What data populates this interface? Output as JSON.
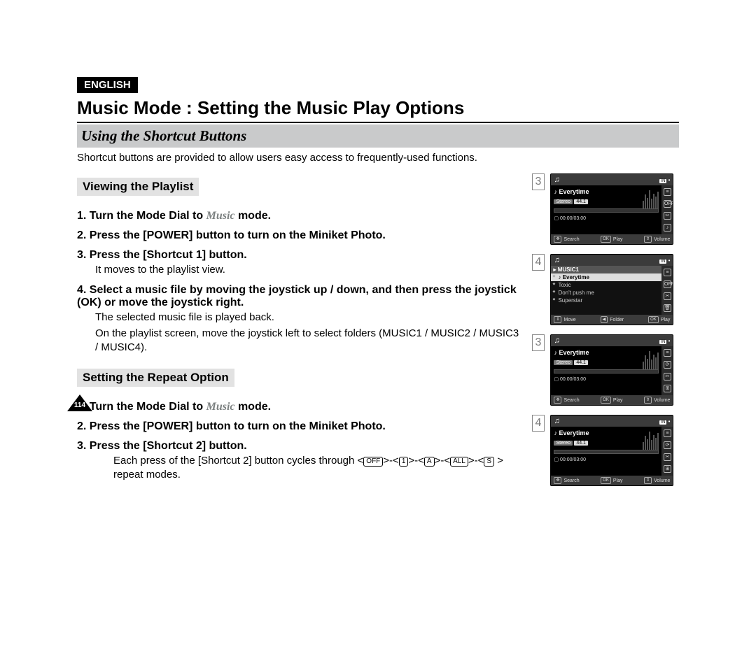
{
  "lang_badge": "ENGLISH",
  "title": "Music Mode : Setting the Music Play Options",
  "section_title": "Using the Shortcut Buttons",
  "intro": "Shortcut buttons are provided to allow users easy access to frequently-used functions.",
  "page_number": "114",
  "viewing": {
    "heading": "Viewing the Playlist",
    "steps": {
      "s1_prefix": "1. Turn the Mode Dial to ",
      "s1_mode": "Music",
      "s1_suffix": " mode.",
      "s2": "2. Press the [POWER] button to turn on the Miniket Photo.",
      "s3": "3. Press the [Shortcut 1] button.",
      "s3_sub": "It moves to the playlist view.",
      "s4": "4. Select a music file by moving the joystick up / down, and then press the joystick (OK) or move the joystick right.",
      "s4_sub1": "The selected music file is played back.",
      "s4_sub2": "On the playlist screen, move the joystick left to select folders (MUSIC1 / MUSIC2 / MUSIC3 / MUSIC4)."
    }
  },
  "repeat": {
    "heading": "Setting the Repeat Option",
    "steps": {
      "s1_prefix": "1. Turn the Mode Dial to ",
      "s1_mode": "Music",
      "s1_suffix": " mode.",
      "s2": "2. Press the [POWER] button to turn on the Miniket Photo.",
      "s3": "3. Press the [Shortcut 2] button.",
      "s3_sub_prefix": "Each press of the [Shortcut 2] button cycles through <",
      "s3_sub_mid": ">-<",
      "s3_sub_suffix": " > repeat modes.",
      "icons": [
        "OFF",
        "1",
        "A",
        "ALL",
        "S"
      ]
    }
  },
  "figures": {
    "common": {
      "track": "Everytime",
      "stereo": "Stereo",
      "rate": "44.1",
      "time": "00:00/03:00",
      "in_label": "IN",
      "bottom_play": {
        "search": "Search",
        "ok": "OK",
        "play": "Play",
        "volume": "Volume"
      },
      "bottom_list": {
        "move": "Move",
        "folder": "Folder",
        "ok": "OK",
        "play": "Play"
      }
    },
    "fig_a_num": "3",
    "fig_b_num": "4",
    "fig_c_num": "3",
    "fig_d_num": "4",
    "playlist": {
      "folder": "MUSIC1",
      "items": [
        "Everytime",
        "Toxic",
        "Don't push me",
        "Superstar"
      ]
    },
    "side_icons_play": [
      "≡",
      "OFF",
      "✂",
      "♪"
    ],
    "side_icons_repeat": [
      "≡",
      "⟳",
      "✂",
      "⊞"
    ],
    "side_icons_list": [
      "≡",
      "OFF",
      "✂",
      "🗑"
    ]
  }
}
